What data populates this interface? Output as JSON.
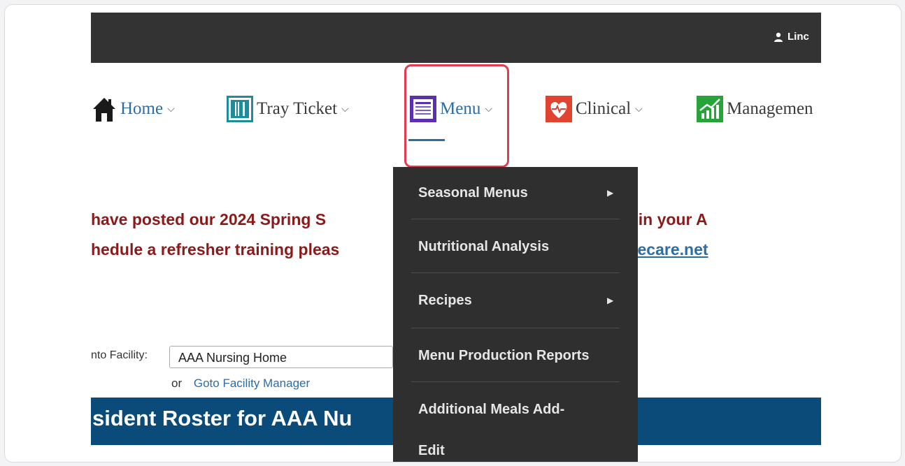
{
  "topbar": {
    "user_name": "Linc"
  },
  "nav": {
    "home": "Home",
    "tray_ticket": "Tray Ticket",
    "menu": "Menu",
    "clinical": "Clinical",
    "management": "Managemen",
    "chevron": "⌵"
  },
  "announcement": {
    "line1_a": "have posted our 2024 Spring S",
    "line1_b": "e available in your A",
    "line2_a": "hedule a refresher training pleas",
    "line2_email": "@supremecare.net"
  },
  "facility": {
    "label": "nto Facility:",
    "value": "AAA Nursing Home",
    "or_text": "or",
    "goto_link": "Goto Facility Manager"
  },
  "roster": {
    "title": "sident Roster for AAA Nu"
  },
  "dropdown": {
    "items": [
      {
        "label": "Seasonal Menus",
        "has_submenu": true
      },
      {
        "label": "Nutritional Analysis",
        "has_submenu": false
      },
      {
        "label": "Recipes",
        "has_submenu": true
      },
      {
        "label": "Menu Production Reports",
        "has_submenu": false
      },
      {
        "label": "Additional Meals Add-",
        "has_submenu": false
      },
      {
        "label": "Edit",
        "has_submenu": false
      }
    ],
    "arrow": "▶"
  },
  "colors": {
    "topbar": "#333333",
    "roster_bar": "#0a4b7a",
    "announcement": "#8b1a1a",
    "link": "#2e6da4",
    "highlight": "#e33b52",
    "dropdown_bg": "#2f2f2f"
  }
}
